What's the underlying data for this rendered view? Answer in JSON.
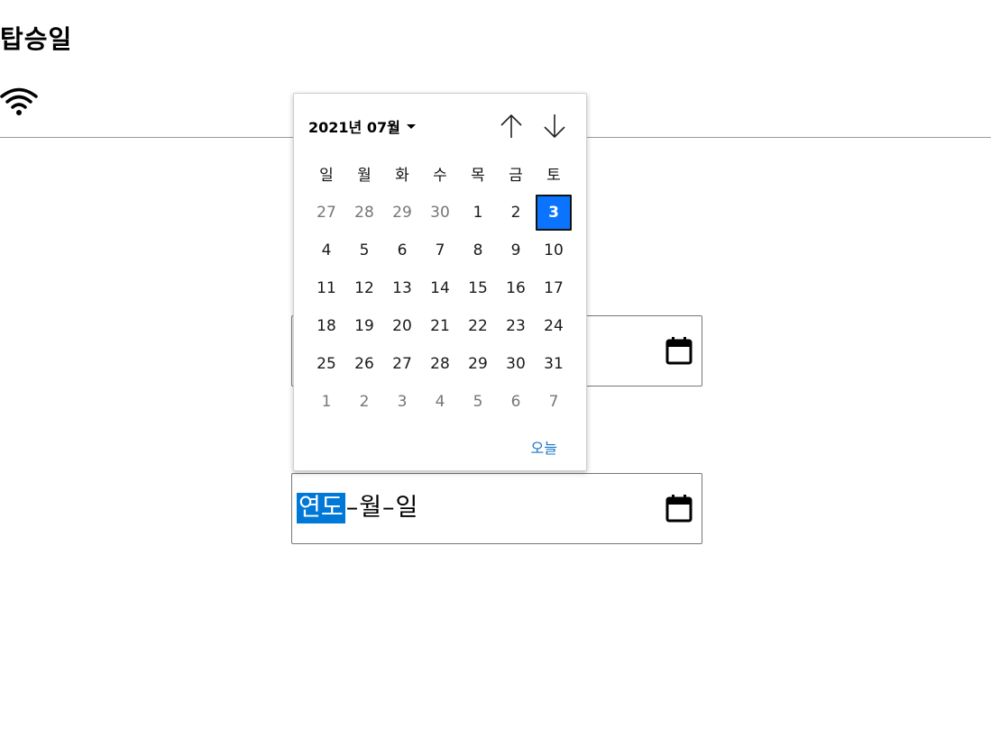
{
  "page": {
    "title": "탑승일"
  },
  "calendar": {
    "month_label": "2021년 07월",
    "weekdays": [
      "일",
      "월",
      "화",
      "수",
      "목",
      "금",
      "토"
    ],
    "weeks": [
      [
        "27",
        "28",
        "29",
        "30",
        "1",
        "2",
        "3"
      ],
      [
        "4",
        "5",
        "6",
        "7",
        "8",
        "9",
        "10"
      ],
      [
        "11",
        "12",
        "13",
        "14",
        "15",
        "16",
        "17"
      ],
      [
        "18",
        "19",
        "20",
        "21",
        "22",
        "23",
        "24"
      ],
      [
        "25",
        "26",
        "27",
        "28",
        "29",
        "30",
        "31"
      ],
      [
        "1",
        "2",
        "3",
        "4",
        "5",
        "6",
        "7"
      ]
    ],
    "selected_day": "3",
    "today_label": "오늘",
    "accent": "#0b74ff"
  },
  "date_field_2": {
    "year_placeholder": "연도",
    "month_placeholder": "월",
    "day_placeholder": "일",
    "separator": "–",
    "highlight": "#0078d7"
  },
  "icons": {
    "wifi": "wifi-icon",
    "calendar": "calendar-icon",
    "up": "arrow-up-icon",
    "down": "arrow-down-icon"
  }
}
